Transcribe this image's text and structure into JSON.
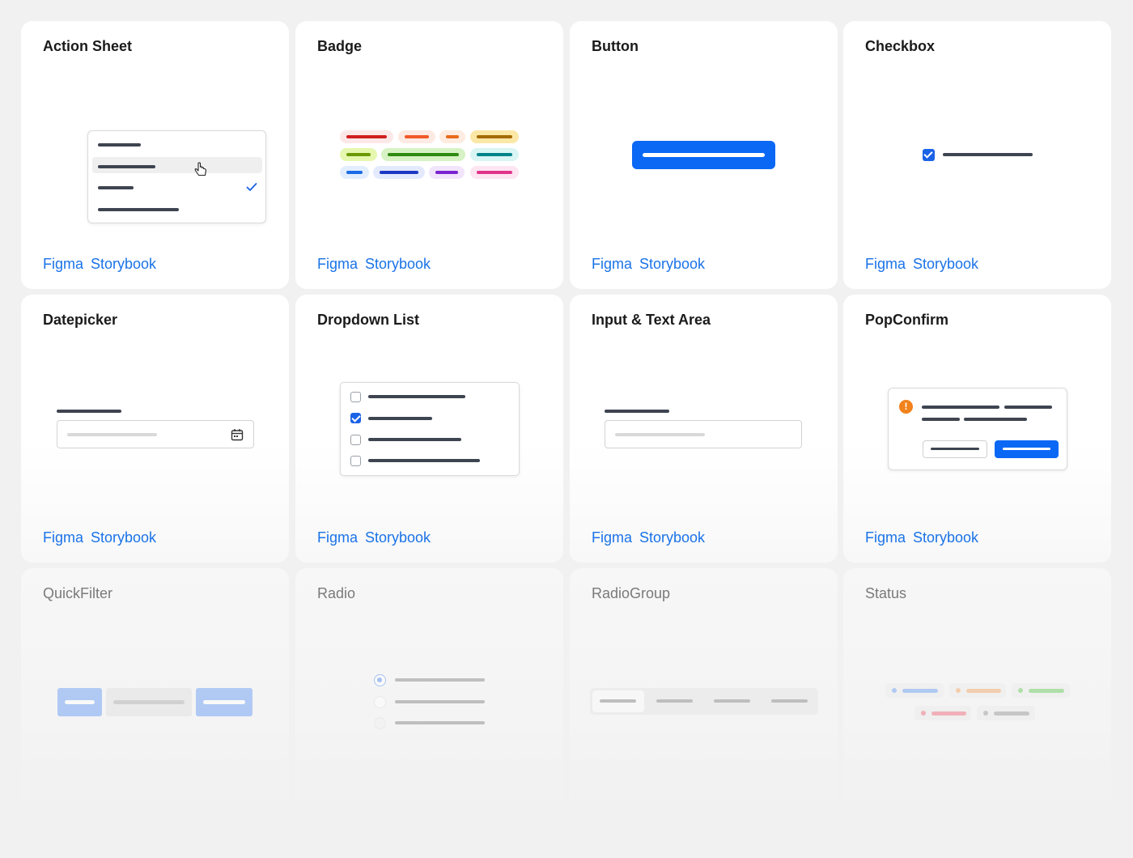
{
  "links": {
    "figma": "Figma",
    "storybook": "Storybook"
  },
  "components": [
    {
      "title": "Action Sheet",
      "preview": "action-sheet",
      "state": "available"
    },
    {
      "title": "Badge",
      "preview": "badge",
      "state": "available"
    },
    {
      "title": "Button",
      "preview": "button",
      "state": "available"
    },
    {
      "title": "Checkbox",
      "preview": "checkbox",
      "state": "available"
    },
    {
      "title": "Datepicker",
      "preview": "datepicker",
      "state": "available"
    },
    {
      "title": "Dropdown List",
      "preview": "dropdown-list",
      "state": "available"
    },
    {
      "title": "Input & Text Area",
      "preview": "input",
      "state": "available"
    },
    {
      "title": "PopConfirm",
      "preview": "popconfirm",
      "state": "available"
    },
    {
      "title": "QuickFilter",
      "preview": "quickfilter",
      "state": "muted"
    },
    {
      "title": "Radio",
      "preview": "radio",
      "state": "muted"
    },
    {
      "title": "RadioGroup",
      "preview": "radiogroup",
      "state": "muted"
    },
    {
      "title": "Status",
      "preview": "status",
      "state": "muted"
    }
  ],
  "colors": {
    "link": "#1a73e8",
    "primary": "#0b68f5",
    "warning": "#f2821b",
    "background": "#f1f1f1"
  },
  "icons": [
    "pointer-hand-icon",
    "checkmark-icon",
    "calendar-icon",
    "warning-icon"
  ]
}
